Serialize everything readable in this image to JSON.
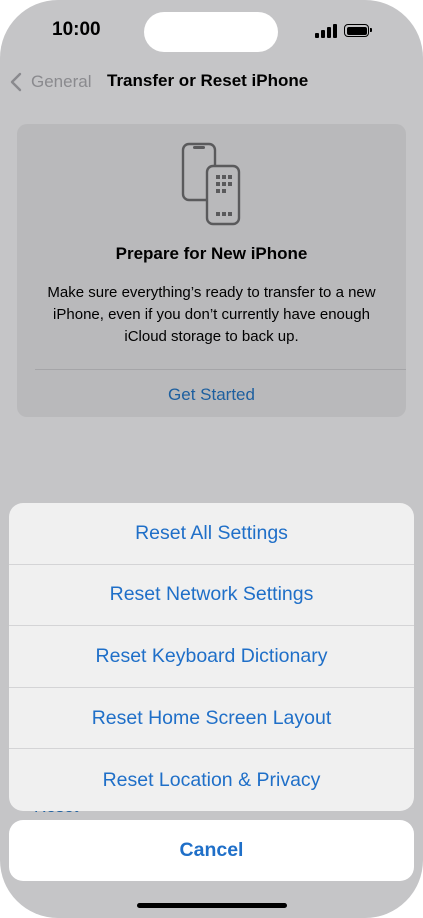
{
  "status_bar": {
    "time": "10:00",
    "signal_icon": "cellular-signal-icon",
    "battery_icon": "battery-full-icon"
  },
  "nav": {
    "back_label": "General",
    "title": "Transfer or Reset iPhone"
  },
  "prepare_card": {
    "icon": "two-phones-transfer-icon",
    "title": "Prepare for New iPhone",
    "description": "Make sure everything’s ready to transfer to a new iPhone, even if you don’t currently have enough iCloud storage to back up.",
    "action_label": "Get Started"
  },
  "background_peek_text": "Reset",
  "action_sheet": {
    "items": [
      {
        "label": "Reset All Settings"
      },
      {
        "label": "Reset Network Settings"
      },
      {
        "label": "Reset Keyboard Dictionary"
      },
      {
        "label": "Reset Home Screen Layout"
      },
      {
        "label": "Reset Location & Privacy"
      }
    ],
    "cancel_label": "Cancel"
  },
  "colors": {
    "accent": "#1f6fc8",
    "dimmed_background": "#c5c5c7",
    "sheet_background": "#f0f0f0"
  }
}
